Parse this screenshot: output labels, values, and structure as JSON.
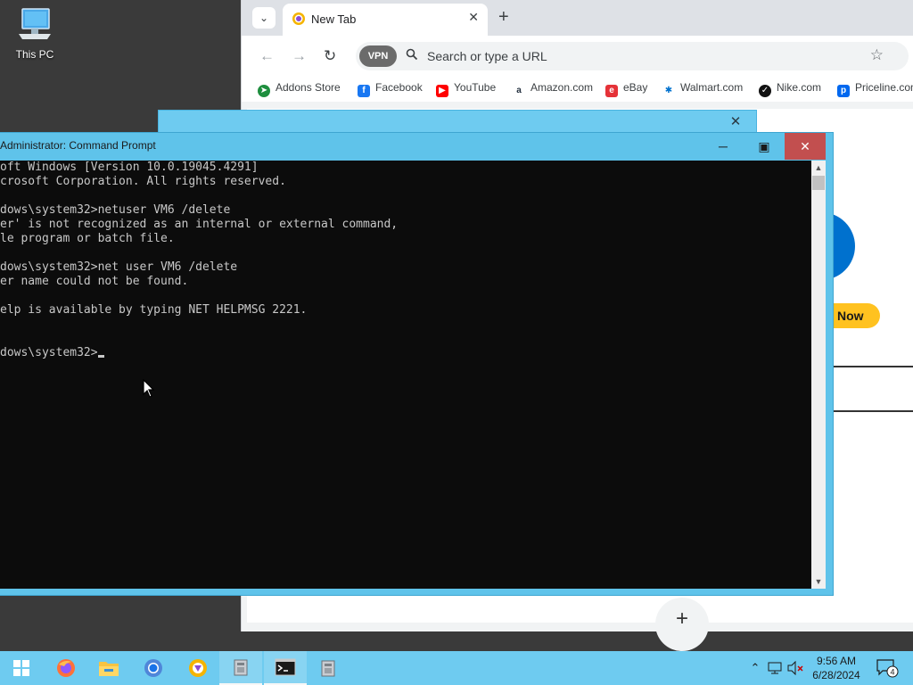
{
  "desktop": {
    "icons": [
      {
        "label": "This PC",
        "icon": "computer-icon"
      }
    ]
  },
  "browser": {
    "tab_title": "New Tab",
    "omnibox_placeholder": "Search or type a URL",
    "vpn_label": "VPN",
    "bookmarks": [
      {
        "label": "Addons Store",
        "icon": "addons-icon",
        "color": "#1e8e3e"
      },
      {
        "label": "Facebook",
        "icon": "facebook-icon",
        "color": "#1877f2"
      },
      {
        "label": "YouTube",
        "icon": "youtube-icon",
        "color": "#ff0000"
      },
      {
        "label": "Amazon.com",
        "icon": "amazon-icon",
        "color": "#232f3e"
      },
      {
        "label": "eBay",
        "icon": "ebay-icon",
        "color": "#e53238"
      },
      {
        "label": "Walmart.com",
        "icon": "walmart-icon",
        "color": "#0071ce"
      },
      {
        "label": "Nike.com",
        "icon": "nike-icon",
        "color": "#111111"
      },
      {
        "label": "Priceline.com",
        "icon": "priceline-icon",
        "color": "#0068ef"
      }
    ],
    "page": {
      "cta_label": "Now"
    }
  },
  "cmd_window": {
    "title": "Administrator: Command Prompt",
    "lines": [
      "oft Windows [Version 10.0.19045.4291]",
      "crosoft Corporation. All rights reserved.",
      "",
      "dows\\system32>netuser VM6 /delete",
      "er' is not recognized as an internal or external command,",
      "le program or batch file.",
      "",
      "dows\\system32>net user VM6 /delete",
      "er name could not be found.",
      "",
      "elp is available by typing NET HELPMSG 2221.",
      "",
      "",
      "dows\\system32>"
    ]
  },
  "taskbar": {
    "items": [
      "start-icon",
      "firefox-icon",
      "file-explorer-icon",
      "chrome-icon",
      "browser-icon",
      "app-icon",
      "command-prompt-icon",
      "app-icon-2"
    ],
    "clock": {
      "time": "9:56 AM",
      "date": "6/28/2024"
    },
    "notification_count": "4"
  },
  "colors": {
    "taskbar": "#6ecbf0",
    "cmd_frame": "#5fc3ea",
    "close_button": "#c24f4f",
    "console_bg": "#0c0c0c"
  }
}
